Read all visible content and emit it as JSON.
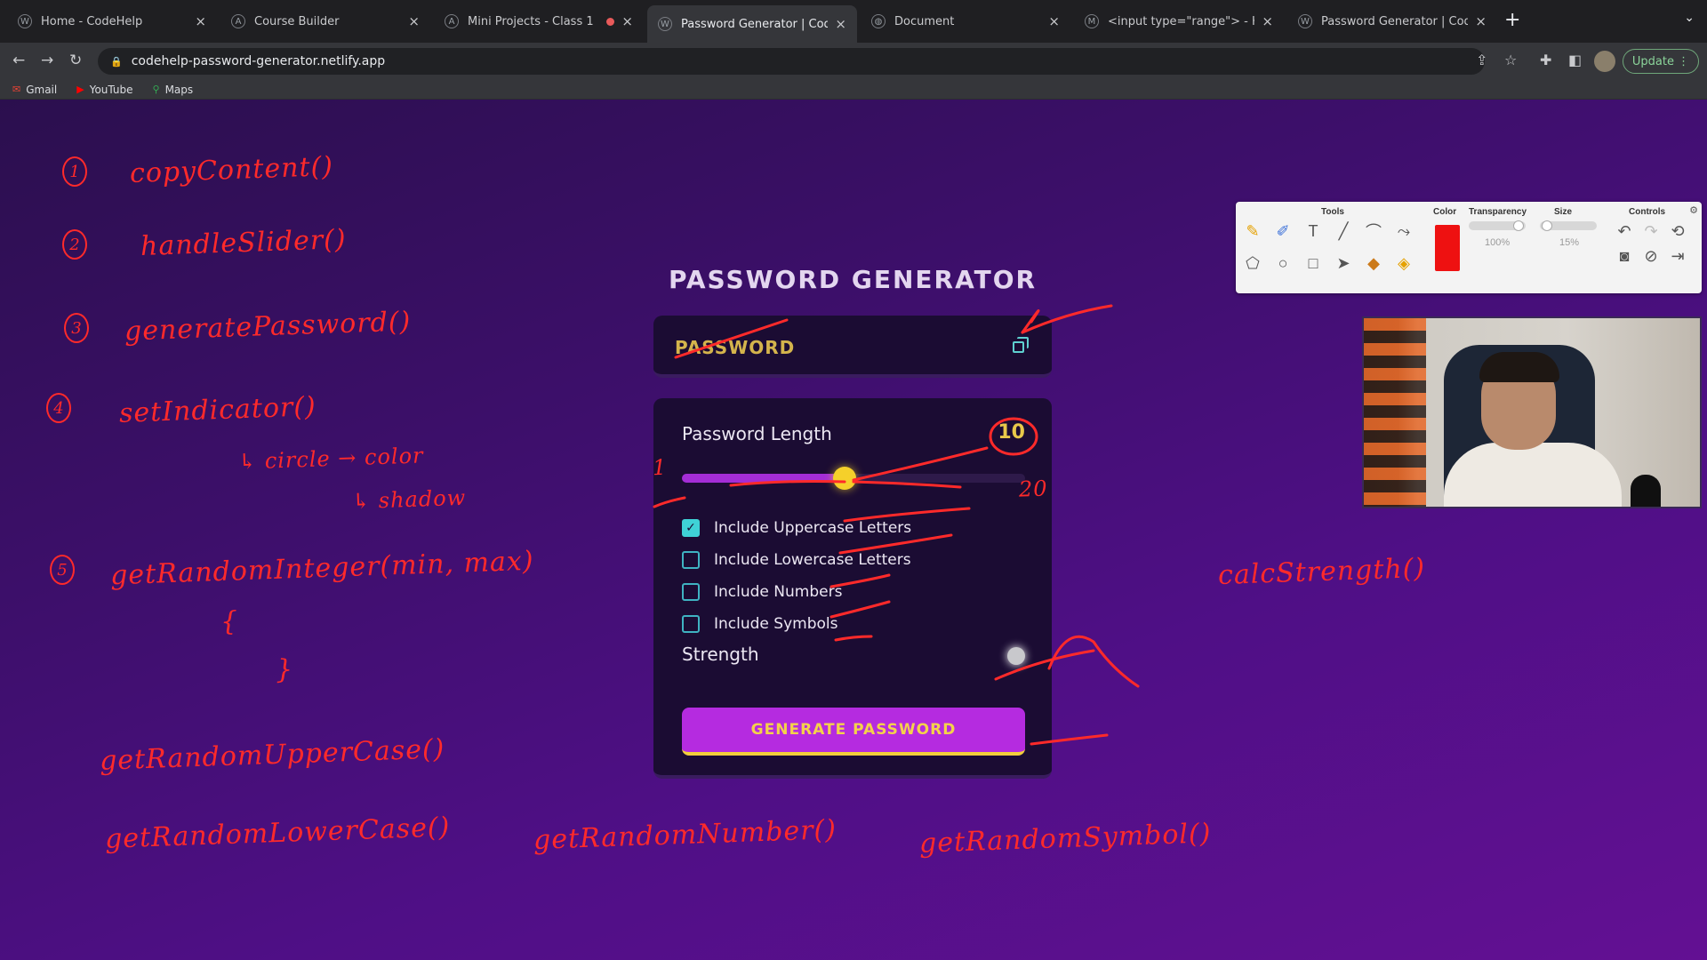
{
  "browser": {
    "tabs": [
      {
        "title": "Home - CodeHelp",
        "active": false,
        "recording": false
      },
      {
        "title": "Course Builder",
        "active": false,
        "recording": false
      },
      {
        "title": "Mini Projects - Class 1",
        "active": false,
        "recording": true
      },
      {
        "title": "Password Generator | CodeHel",
        "active": true,
        "recording": false
      },
      {
        "title": "Document",
        "active": false,
        "recording": false
      },
      {
        "title": "<input type=\"range\"> - HTML",
        "active": false,
        "recording": false
      },
      {
        "title": "Password Generator | CodeHel",
        "active": false,
        "recording": false
      }
    ],
    "url": "codehelp-password-generator.netlify.app",
    "update_label": "Update",
    "bookmarks": [
      "Gmail",
      "YouTube",
      "Maps"
    ]
  },
  "app": {
    "title": "PASSWORD GENERATOR",
    "password_placeholder": "PASSWORD",
    "length_label": "Password Length",
    "length_value": "10",
    "slider": {
      "min": 1,
      "max": 20,
      "value": 10
    },
    "options": [
      {
        "label": "Include Uppercase Letters",
        "checked": true
      },
      {
        "label": "Include Lowercase Letters",
        "checked": false
      },
      {
        "label": "Include Numbers",
        "checked": false
      },
      {
        "label": "Include Symbols",
        "checked": false
      }
    ],
    "strength_label": "Strength",
    "generate_label": "GENERATE PASSWORD"
  },
  "palette": {
    "headers": {
      "tools": "Tools",
      "color": "Color",
      "transparency": "Transparency",
      "size": "Size",
      "controls": "Controls"
    },
    "transparency_value": "100%",
    "size_value": "15%",
    "active_color": "#ee1111"
  },
  "annotations": {
    "n1": "1",
    "n2": "2",
    "n3": "3",
    "n4": "4",
    "n5": "5",
    "copy": "copyContent()",
    "slider": "handleSlider()",
    "generate": "generatePassword()",
    "indicator": "setIndicator()",
    "circle": "↳ circle → color",
    "shadow": "↳ shadow",
    "random_int": "getRandomInteger(min, max)",
    "brace_open": "{",
    "brace_close": "}",
    "upper": "getRandomUpperCase()",
    "lower": "getRandomLowerCase()",
    "number": "getRandomNumber()",
    "symbol": "getRandomSymbol()",
    "strength": "calcStrength()",
    "slider_min": "1",
    "slider_max": "20"
  },
  "colors": {
    "accent_purple": "#b52be0",
    "accent_yellow": "#f5d02a",
    "ink_red": "#ff2a2a",
    "check_teal": "#3fd2d6"
  }
}
